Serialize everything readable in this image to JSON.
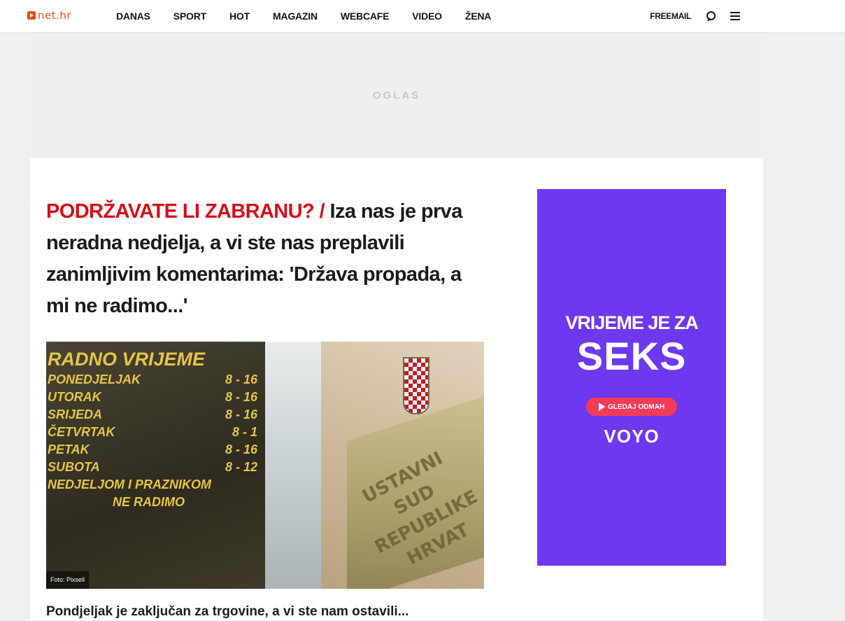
{
  "header": {
    "logo_text": "net.hr",
    "nav": [
      "DANAS",
      "SPORT",
      "HOT",
      "MAGAZIN",
      "WEBCAFE",
      "VIDEO",
      "ŽENA"
    ],
    "freemail": "FREEMAIL"
  },
  "ad_banner": {
    "label": "OGLAS"
  },
  "article": {
    "kicker": "PODRŽAVATE LI ZABRANU? /",
    "title": " Iza nas je prva neradna nedjelja, a vi ste nas preplavili zanimljivim komentarima: 'Država propada, a mi ne radimo...'",
    "photo": {
      "sign_title": "RADNO VRIJEME",
      "sign_rows": [
        {
          "day": "PONEDJELJAK",
          "time": "8 - 16"
        },
        {
          "day": "UTORAK",
          "time": "8 - 16"
        },
        {
          "day": "SRIJEDA",
          "time": "8 - 16"
        },
        {
          "day": "ČETVRTAK",
          "time": "8 - 1"
        },
        {
          "day": "PETAK",
          "time": "8 - 16"
        },
        {
          "day": "SUBOTA",
          "time": "8 - 12"
        }
      ],
      "sign_footer_1": "NEDJELJOM I PRAZNIKOM",
      "sign_footer_2": "NE RADIMO",
      "plaque_text": "USTAVNI SUD REPUBLIKE HRVAT",
      "credit": "Foto: Pixsell"
    },
    "lead_partial": "Pondjeljak je zaključan za trgovine, a vi ste nam ostavili..."
  },
  "side_ad": {
    "line1": "VRIJEME JE ZA",
    "line2": "SEKS",
    "button": "GLEDAJ ODMAH",
    "brand": "VOYO",
    "bg_color": "#6d38ee",
    "button_color": "#f23b57"
  },
  "colors": {
    "kicker": "#d50f1a",
    "logo": "#e74b1a"
  }
}
